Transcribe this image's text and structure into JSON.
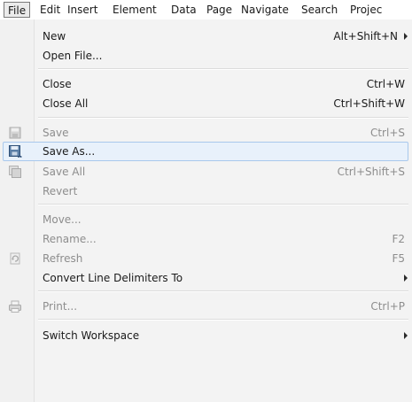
{
  "menubar": {
    "items": [
      "File",
      "Edit",
      "Insert",
      "Element",
      "Data",
      "Page",
      "Navigate",
      "Search",
      "Projec"
    ]
  },
  "menu": {
    "items": [
      {
        "label": "New",
        "accel": "Alt+Shift+N",
        "submenu": true,
        "enabled": true
      },
      {
        "label": "Open File...",
        "accel": "",
        "enabled": true
      },
      {
        "label": "Close",
        "accel": "Ctrl+W",
        "enabled": true
      },
      {
        "label": "Close All",
        "accel": "Ctrl+Shift+W",
        "enabled": true
      },
      {
        "label": "Save",
        "accel": "Ctrl+S",
        "enabled": false,
        "icon": "floppy-icon"
      },
      {
        "label": "Save As...",
        "accel": "",
        "enabled": true,
        "highlighted": true,
        "icon": "save-as-icon"
      },
      {
        "label": "Save All",
        "accel": "Ctrl+Shift+S",
        "enabled": false,
        "icon": "save-all-icon"
      },
      {
        "label": "Revert",
        "accel": "",
        "enabled": false
      },
      {
        "label": "Move...",
        "accel": "",
        "enabled": false
      },
      {
        "label": "Rename...",
        "accel": "F2",
        "enabled": false
      },
      {
        "label": "Refresh",
        "accel": "F5",
        "enabled": false,
        "icon": "refresh-icon"
      },
      {
        "label": "Convert Line Delimiters To",
        "accel": "",
        "submenu": true,
        "enabled": true
      },
      {
        "label": "Print...",
        "accel": "Ctrl+P",
        "enabled": false,
        "icon": "printer-icon"
      },
      {
        "label": "Switch Workspace",
        "accel": "",
        "submenu": true,
        "enabled": true
      }
    ]
  },
  "colors": {
    "highlight_bg": "#e8f1fb",
    "highlight_border": "#a8c8ec",
    "disabled_text": "#8d8d8d"
  }
}
